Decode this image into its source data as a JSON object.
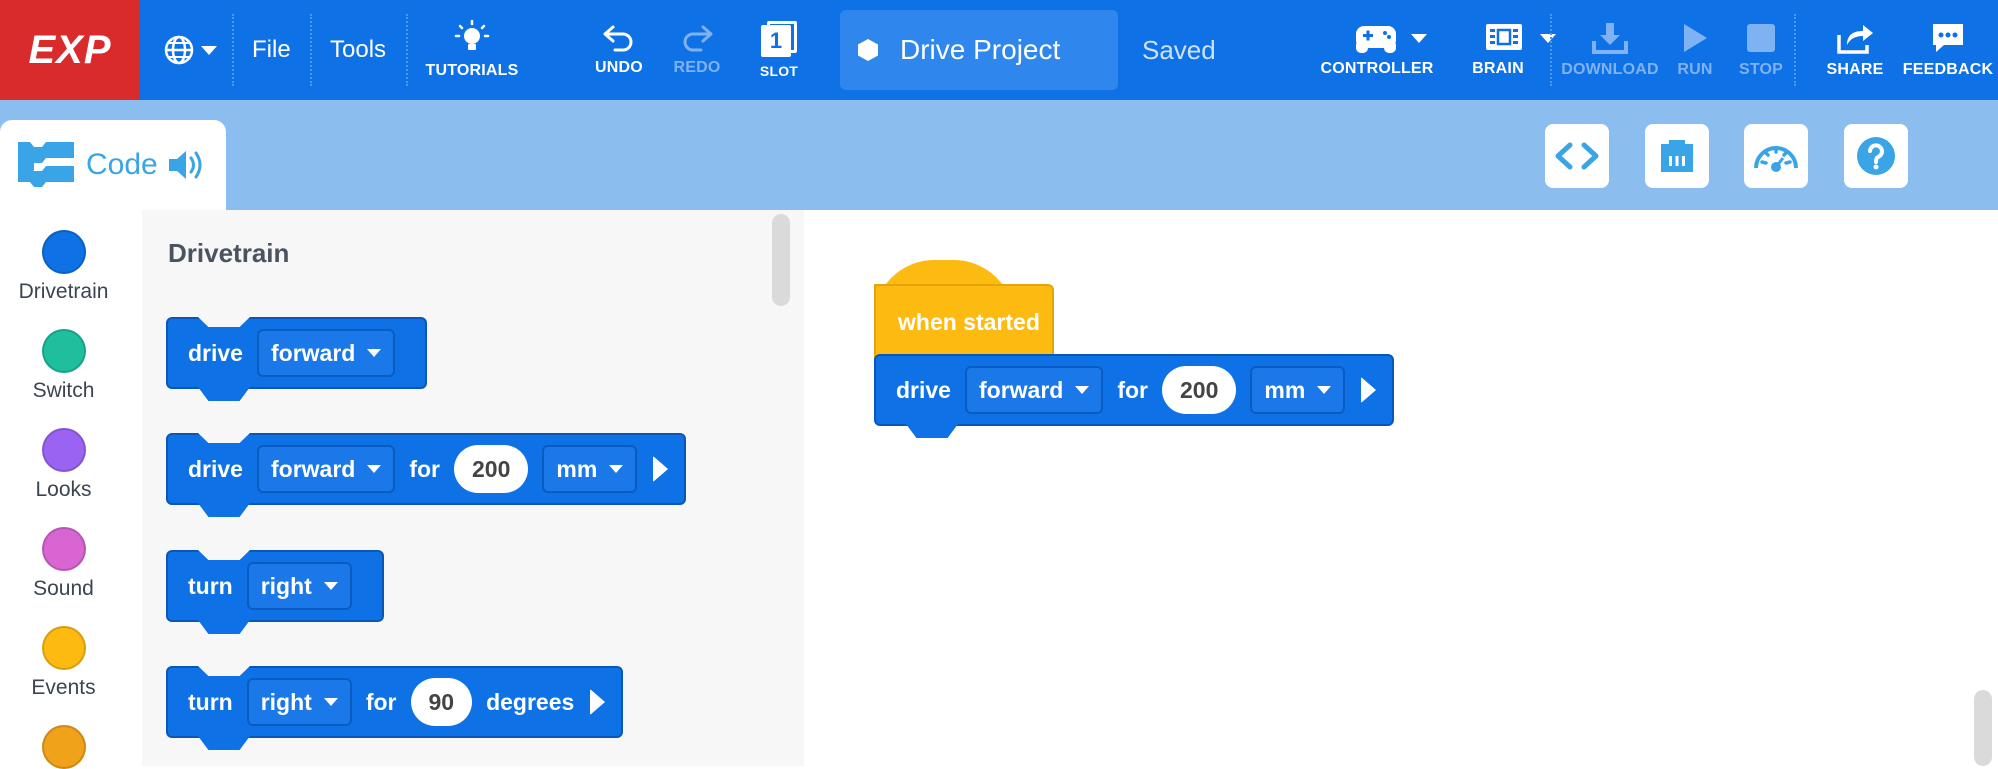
{
  "menubar": {
    "logo": "EXP",
    "file": "File",
    "tools": "Tools",
    "tutorials": "TUTORIALS",
    "undo": "UNDO",
    "redo": "REDO",
    "slot_number": "1",
    "slot": "SLOT",
    "project_name": "Drive Project",
    "status": "Saved",
    "controller": "CONTROLLER",
    "brain": "BRAIN",
    "download": "DOWNLOAD",
    "run": "RUN",
    "stop": "STOP",
    "share": "SHARE",
    "feedback": "FEEDBACK"
  },
  "code_tab": {
    "label": "Code"
  },
  "toolbar_icons": [
    "code-view-icon",
    "devices-icon",
    "dashboard-icon",
    "help-icon"
  ],
  "categories": [
    {
      "name": "Drivetrain",
      "color": "#0e71e6"
    },
    {
      "name": "Switch",
      "color": "#1fbf9d"
    },
    {
      "name": "Looks",
      "color": "#9b63f2"
    },
    {
      "name": "Sound",
      "color": "#d865d2"
    },
    {
      "name": "Events",
      "color": "#fdbb12"
    },
    {
      "name": "",
      "color": "#f0a21a"
    }
  ],
  "palette": {
    "title": "Drivetrain",
    "blocks": {
      "b1": {
        "word": "drive",
        "dir": "forward"
      },
      "b2": {
        "word": "drive",
        "dir": "forward",
        "for": "for",
        "value": "200",
        "unit": "mm"
      },
      "b3": {
        "word": "turn",
        "dir": "right"
      },
      "b4": {
        "word": "turn",
        "dir": "right",
        "for": "for",
        "value": "90",
        "unit": "degrees"
      }
    }
  },
  "workspace": {
    "hat": "when started",
    "block": {
      "word": "drive",
      "dir": "forward",
      "for": "for",
      "value": "200",
      "unit": "mm"
    }
  }
}
